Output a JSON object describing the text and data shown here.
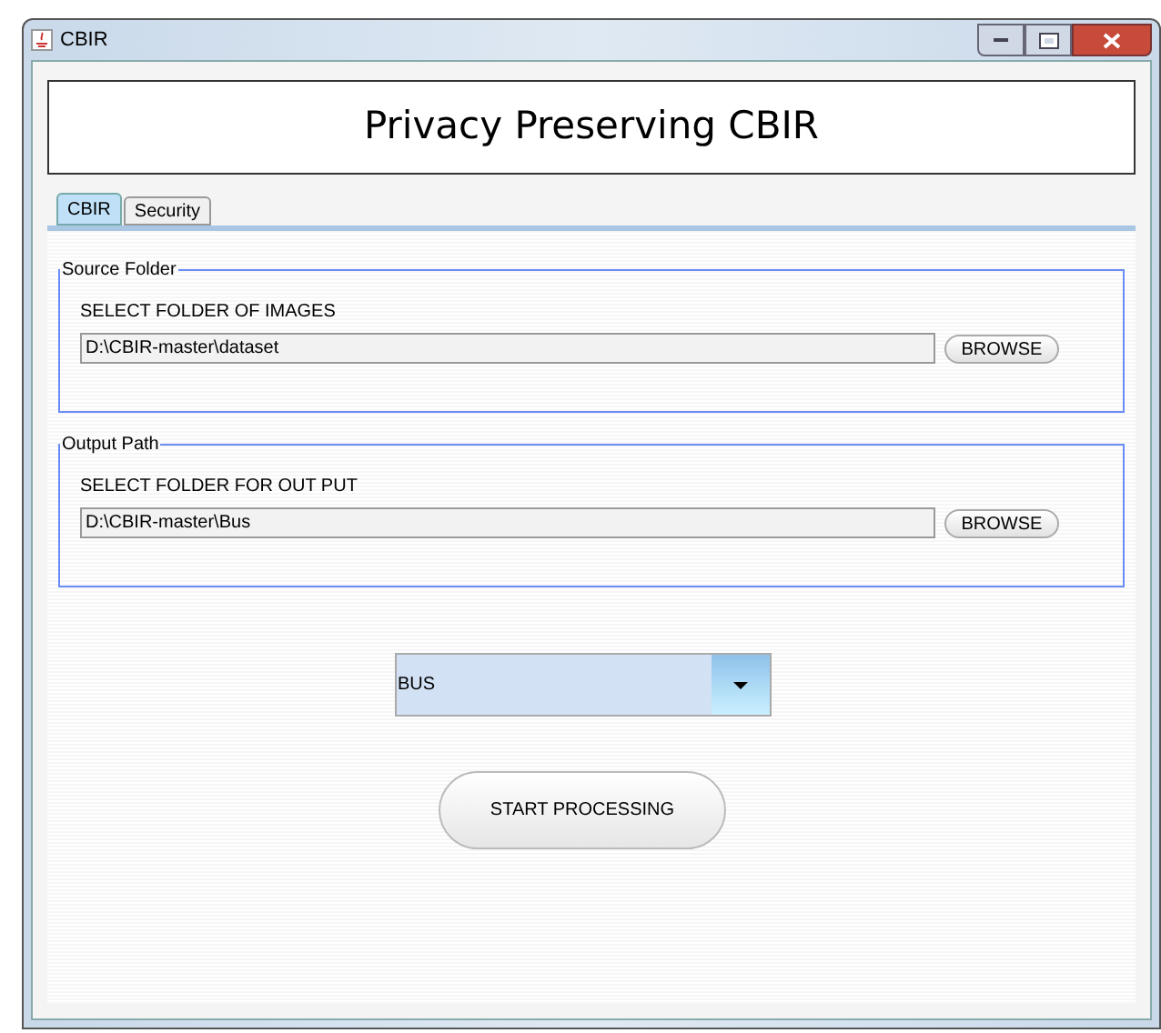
{
  "window": {
    "title": "CBIR"
  },
  "header": {
    "title": "Privacy Preserving CBIR"
  },
  "tabs": [
    {
      "label": "CBIR",
      "selected": true
    },
    {
      "label": "Security",
      "selected": false
    }
  ],
  "sections": [
    {
      "legend": "Source Folder",
      "label": "SELECT FOLDER OF IMAGES",
      "value": "D:\\CBIR-master\\dataset",
      "button": "BROWSE"
    },
    {
      "legend": "Output Path",
      "label": "SELECT FOLDER FOR OUT PUT",
      "value": "D:\\CBIR-master\\Bus",
      "button": "BROWSE"
    }
  ],
  "dropdown": {
    "value": "BUS"
  },
  "start_button": "START PROCESSING"
}
